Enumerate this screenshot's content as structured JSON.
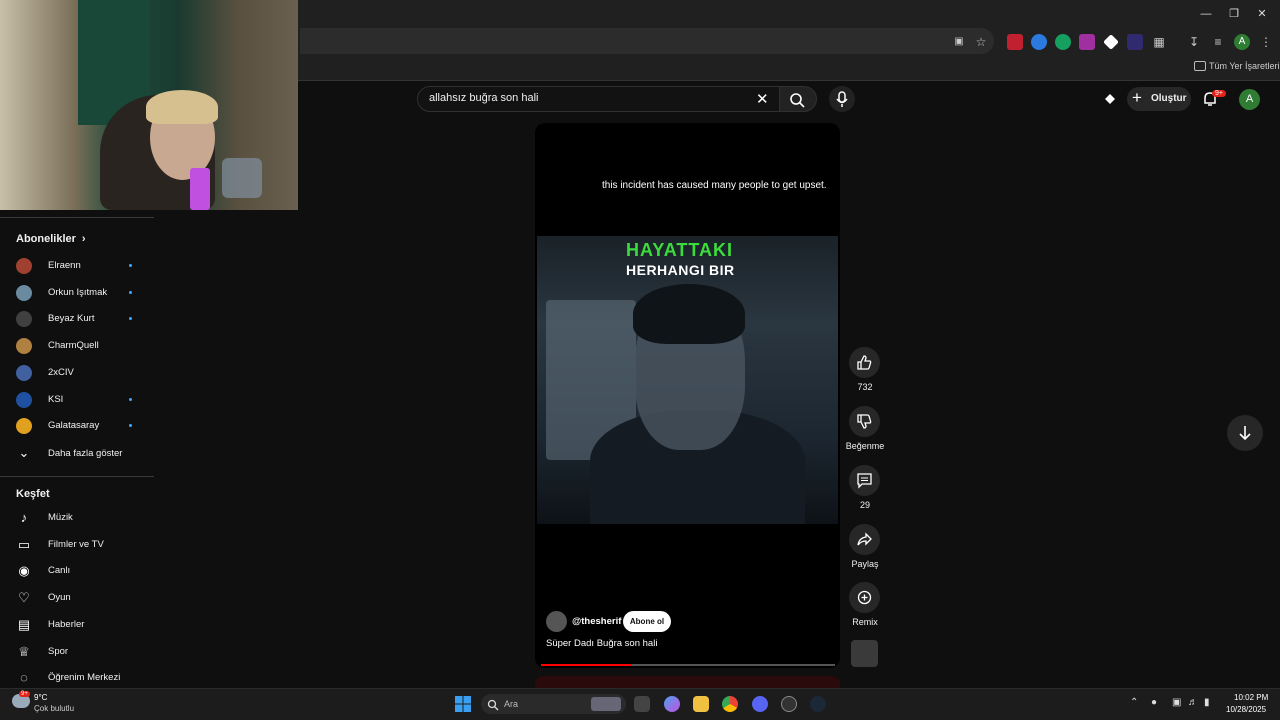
{
  "browser": {
    "bookmarks_folder": "Tüm Yer İşaretleri"
  },
  "header": {
    "search_query": "allahsız buğra son hali",
    "create_label": "Oluştur",
    "notifications_badge": "9+",
    "avatar_letter": "A"
  },
  "sidebar": {
    "subscriptions_title": "Abonelikler",
    "subscriptions": [
      {
        "label": "Elraenn",
        "new": true,
        "color": "#a04030"
      },
      {
        "label": "Orkun Işıtmak",
        "new": true,
        "color": "#6a8aa0"
      },
      {
        "label": "Beyaz Kurt",
        "new": true,
        "color": "#404040"
      },
      {
        "label": "CharmQuell",
        "new": false,
        "color": "#b08040"
      },
      {
        "label": "2xCIV",
        "new": false,
        "color": "#4060a0"
      },
      {
        "label": "KSI",
        "new": true,
        "color": "#2050a0"
      },
      {
        "label": "Galatasaray",
        "new": true,
        "color": "#e0a020"
      }
    ],
    "show_more": "Daha fazla göster",
    "explore_title": "Keşfet",
    "explore": [
      {
        "label": "Müzik",
        "icon": "music-note-icon"
      },
      {
        "label": "Filmler ve TV",
        "icon": "film-icon"
      },
      {
        "label": "Canlı",
        "icon": "live-icon"
      },
      {
        "label": "Oyun",
        "icon": "gaming-icon"
      },
      {
        "label": "Haberler",
        "icon": "news-icon"
      },
      {
        "label": "Spor",
        "icon": "trophy-icon"
      },
      {
        "label": "Öğrenim Merkezi",
        "icon": "bulb-icon"
      }
    ]
  },
  "video": {
    "caption": "this incident has caused many people to get upset.",
    "overlay_line1": "HAYATTAKI",
    "overlay_line2": "HERHANGI BIR",
    "channel": "@thesherif",
    "subscribe_label": "Abone ol",
    "title": "Süper Dadı Buğra son hali",
    "progress": 0.31
  },
  "actions": {
    "likes": "732",
    "dislike_label": "Beğenme",
    "comments": "29",
    "share_label": "Paylaş",
    "remix_label": "Remix"
  },
  "taskbar": {
    "weather_temp": "9°C",
    "weather_desc": "Çok bulutlu",
    "weather_badge": "9+",
    "search_label": "Ara",
    "clock_time": "10:02 PM",
    "clock_date": "10/28/2025"
  }
}
